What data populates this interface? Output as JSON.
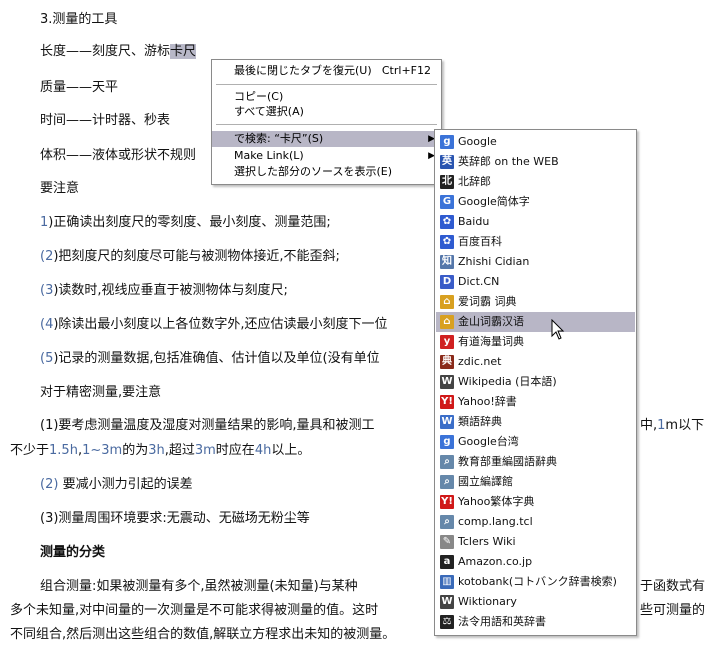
{
  "document": {
    "p1": "3.测量的工具",
    "p2_a": "长度——刻度尺、游标",
    "p2_b": "卡尺",
    "p3": "质量——天平",
    "p4": "时间——计时器、秒表",
    "p5": "体积——液体或形状不规则",
    "p6": "要注意",
    "p7_num": "1",
    "p7": ")正确读出刻度尺的零刻度、最小刻度、测量范围;",
    "p8_num": "(2",
    "p8": ")把刻度尺的刻度尽可能与被测物体接近,不能歪斜;",
    "p9_num": "(3",
    "p9": ")读数时,视线应垂直于被测物体与刻度尺;",
    "p10_num": "(4",
    "p10": ")除读出最小刻度以上各位数字外,还应估读最小刻度下一位",
    "p11_num": "(5",
    "p11": ")记录的测量数据,包括准确值、估计值以及单位(没有单位",
    "p12": "对于精密测量,要注意",
    "p13_a": "(1)要考虑测量温度及湿度对测量结果的影响,量具和被测工",
    "p13_b": "中,",
    "p13_c": "1",
    "p13_d": "m以下",
    "p14_a": "不少于",
    "p14_b": "1.5h",
    "p14_c": ",",
    "p14_d": "1~3m",
    "p14_e": "的为",
    "p14_f": "3h",
    "p14_g": ",超过",
    "p14_h": "3m",
    "p14_i": "时应在",
    "p14_j": "4h",
    "p14_k": "以上。",
    "p15_num": "(2)",
    "p15": "要减小测力引起的误差",
    "p16": "(3)测量周围环境要求:无震动、无磁场无粉尘等",
    "p17": "测量的分类",
    "p18_a": "组合测量:如果被测量有多个,虽然被测量(未知量)与某种",
    "p18_b": "于函数式有",
    "p19_a": "多个未知量,对中间量的一次测量是不可能求得被测量的值。这时",
    "p19_b": "些可测量的",
    "p20": "不同组合,然后测出这些组合的数值,解联立方程求出未知的被测量。"
  },
  "context_menu": {
    "items": [
      {
        "label": "最後に閉じたタブを復元(U)",
        "shortcut": "Ctrl+F12"
      },
      {
        "label": "コピー(C)"
      },
      {
        "label": "すべて選択(A)"
      },
      {
        "label": "で検索: “卡尺”(S)"
      },
      {
        "label": "Make Link(L)"
      },
      {
        "label": "選択した部分のソースを表示(E)"
      }
    ]
  },
  "submenu": {
    "items": [
      {
        "label": "Google",
        "icon": "google-icon",
        "color": "#3b73d8"
      },
      {
        "label": "英辞郎 on the WEB",
        "icon": "eijiro-icon",
        "color": "#2a55b0"
      },
      {
        "label": "北辞郎",
        "icon": "kitajiro-icon",
        "color": "#222222"
      },
      {
        "label": "Google简体字",
        "icon": "google-jianti-icon",
        "color": "#3b73d8"
      },
      {
        "label": "Baidu",
        "icon": "baidu-icon",
        "color": "#2f5bd0"
      },
      {
        "label": "百度百科",
        "icon": "baidu-baike-icon",
        "color": "#2f5bd0"
      },
      {
        "label": "Zhishi Cidian",
        "icon": "zhishi-icon",
        "color": "#5577aa"
      },
      {
        "label": "Dict.CN",
        "icon": "dictcn-icon",
        "color": "#3a5cc8"
      },
      {
        "label": "爱词霸 词典",
        "icon": "iciba-icon",
        "color": "#d8a020"
      },
      {
        "label": "金山词霸汉语",
        "icon": "jinshan-icon",
        "color": "#d8a020"
      },
      {
        "label": "有道海量词典",
        "icon": "youdao-icon",
        "color": "#d02020"
      },
      {
        "label": "zdic.net",
        "icon": "zdic-icon",
        "color": "#8a2a1a"
      },
      {
        "label": "Wikipedia (日本語)",
        "icon": "wikipedia-icon",
        "color": "#444444"
      },
      {
        "label": "Yahoo!辞書",
        "icon": "yahoo-icon",
        "color": "#d01818"
      },
      {
        "label": "類語辞典",
        "icon": "ruigo-icon",
        "color": "#3b6ec8"
      },
      {
        "label": "Google台湾",
        "icon": "google-taiwan-icon",
        "color": "#3b73d8"
      },
      {
        "label": "教育部重編國語辭典",
        "icon": "magnifier-icon",
        "color": "#6688aa"
      },
      {
        "label": "國立編譯館",
        "icon": "magnifier-icon",
        "color": "#6688aa"
      },
      {
        "label": "Yahoo繁体字典",
        "icon": "yahoo-icon",
        "color": "#d01818"
      },
      {
        "label": "comp.lang.tcl",
        "icon": "magnifier-icon",
        "color": "#6688aa"
      },
      {
        "label": "Tclers Wiki",
        "icon": "feather-icon",
        "color": "#888888"
      },
      {
        "label": "Amazon.co.jp",
        "icon": "amazon-icon",
        "color": "#222222"
      },
      {
        "label": "kotobank(コトバンク辞書検索)",
        "icon": "kotobank-icon",
        "color": "#3a6ab8"
      },
      {
        "label": "Wiktionary",
        "icon": "wiktionary-icon",
        "color": "#444444"
      },
      {
        "label": "法令用語和英辞書",
        "icon": "scales-icon",
        "color": "#222222"
      }
    ]
  }
}
